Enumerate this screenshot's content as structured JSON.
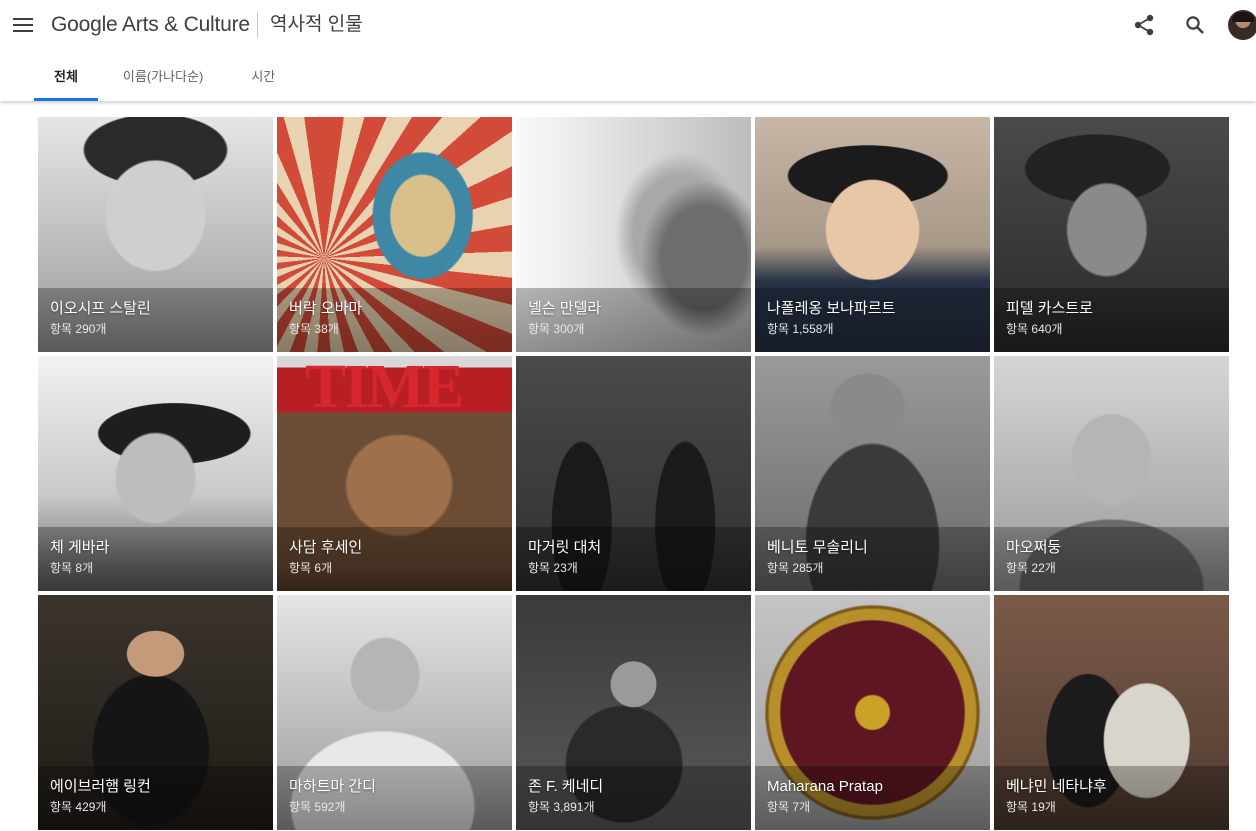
{
  "header": {
    "logo_text": "Google Arts & Culture",
    "page_title": "역사적 인물",
    "icons": {
      "menu": "menu-icon",
      "share": "share-icon",
      "search": "search-icon"
    }
  },
  "tabs": [
    {
      "label": "전체",
      "active": true
    },
    {
      "label": "이름(가나다순)",
      "active": false
    },
    {
      "label": "시간",
      "active": false
    }
  ],
  "accent_color": "#1a73e8",
  "cards": [
    {
      "name": "이오시프 스탈린",
      "count": "항목 290개"
    },
    {
      "name": "버락 오바마",
      "count": "항목 38개"
    },
    {
      "name": "넬슨 만델라",
      "count": "항목 300개"
    },
    {
      "name": "나폴레옹 보나파르트",
      "count": "항목 1,558개"
    },
    {
      "name": "피델 카스트로",
      "count": "항목 640개"
    },
    {
      "name": "체 게바라",
      "count": "항목 8개"
    },
    {
      "name": "사담 후세인",
      "count": "항목 6개",
      "cover_text": "TIME"
    },
    {
      "name": "마거릿 대처",
      "count": "항목 23개"
    },
    {
      "name": "베니토 무솔리니",
      "count": "항목 285개"
    },
    {
      "name": "마오쩌둥",
      "count": "항목 22개"
    },
    {
      "name": "에이브러햄 링컨",
      "count": "항목 429개"
    },
    {
      "name": "마하트마 간디",
      "count": "항목 592개"
    },
    {
      "name": "존 F. 케네디",
      "count": "항목 3,891개"
    },
    {
      "name": "Maharana Pratap",
      "count": "항목 7개"
    },
    {
      "name": "베냐민 네타냐후",
      "count": "항목 19개"
    }
  ]
}
